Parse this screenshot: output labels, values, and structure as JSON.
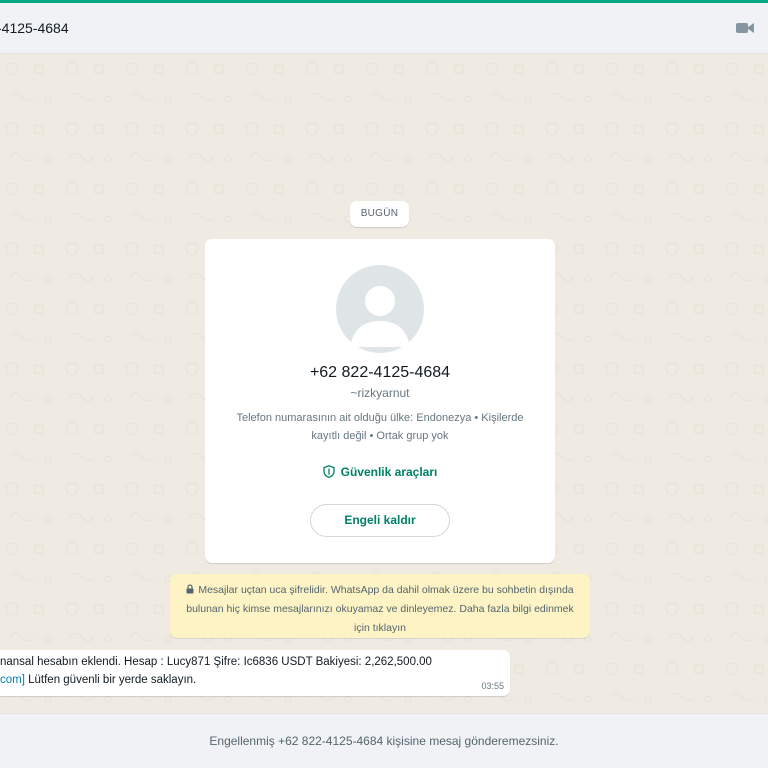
{
  "header": {
    "title": "-4125-4684",
    "video_icon": "video-camera-icon"
  },
  "chat": {
    "date_label": "BUGÜN",
    "contact_card": {
      "phone": "+62 822-4125-4684",
      "username": "~rizkyarnut",
      "info": "Telefon numarasının ait olduğu ülke: Endonezya • Kişilerde kayıtlı değil • Ortak grup yok",
      "security_label": "Güvenlik araçları",
      "unblock_label": "Engeli kaldır"
    },
    "encryption_notice": "Mesajlar uçtan uca şifrelidir. WhatsApp da dahil olmak üzere bu sohbetin dışında bulunan hiç kimse mesajlarınızı okuyamaz ve dinleyemez. Daha fazla bilgi edinmek için tıklayın",
    "message": {
      "line1": "nansal hesabın eklendi. Hesap : Lucy871 Şifre: Ic6836 USDT Bakiyesi: 2,262,500.00",
      "line2_link": "com]",
      "line2_text": " Lütfen güvenli bir yerde saklayın.",
      "time": "03:55"
    }
  },
  "footer": {
    "blocked_notice": "Engellenmiş +62 822-4125-4684 kişisine mesaj gönderemezsiniz."
  },
  "colors": {
    "accent": "#00a884",
    "link": "#027eb5",
    "chat_bg": "#efeae2",
    "notice_bg": "#fdf3c5"
  }
}
